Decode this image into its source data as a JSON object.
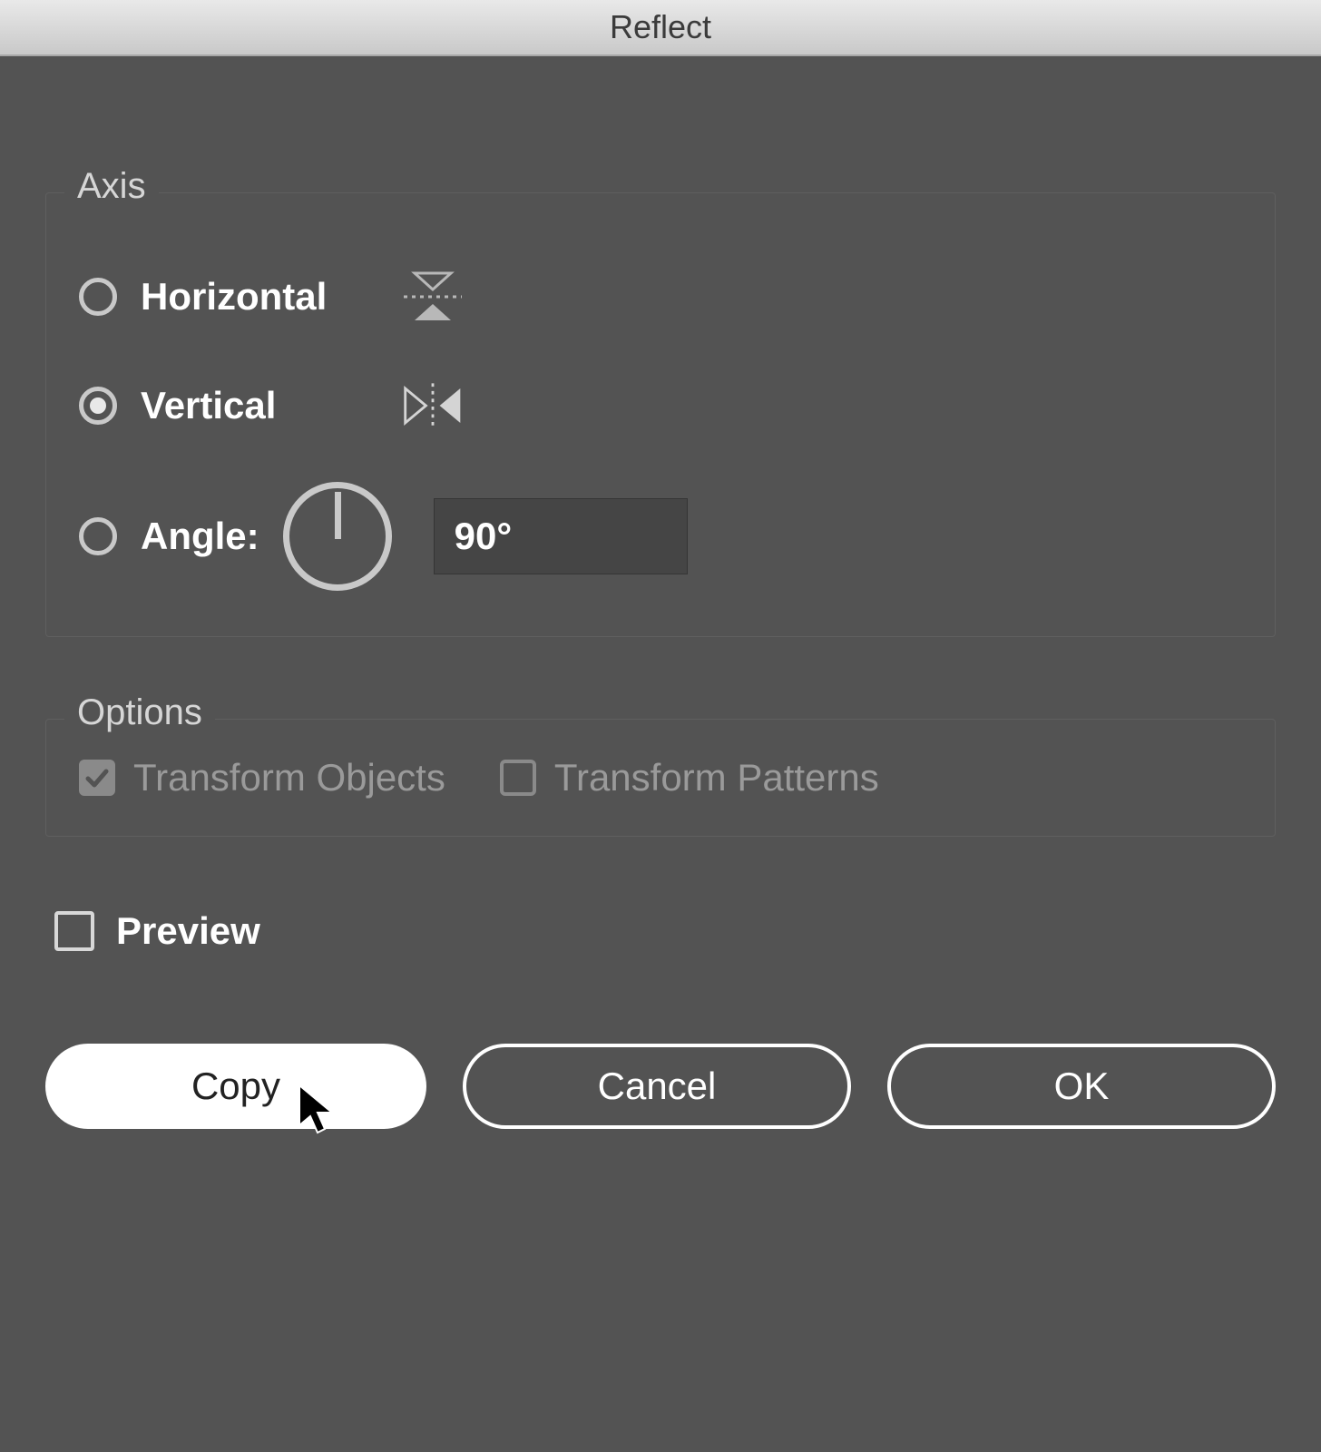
{
  "title": "Reflect",
  "axis": {
    "legend": "Axis",
    "horizontal": {
      "label": "Horizontal",
      "selected": false
    },
    "vertical": {
      "label": "Vertical",
      "selected": true
    },
    "angle": {
      "label": "Angle:",
      "selected": false,
      "value": "90°"
    }
  },
  "options": {
    "legend": "Options",
    "transform_objects": {
      "label": "Transform Objects",
      "checked": true,
      "enabled": false
    },
    "transform_patterns": {
      "label": "Transform Patterns",
      "checked": false,
      "enabled": false
    }
  },
  "preview": {
    "label": "Preview",
    "checked": false
  },
  "buttons": {
    "copy": "Copy",
    "cancel": "Cancel",
    "ok": "OK"
  }
}
